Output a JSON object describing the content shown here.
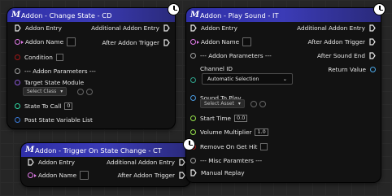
{
  "nodes": {
    "change_state": {
      "title": "Addon - Change State - CD",
      "inputs": {
        "addon_entry": "Addon Entry",
        "addon_name": "Addon Name",
        "condition": "Condition",
        "addon_params": "--- Addon Parameters ---",
        "target_state_module": "Target State Module",
        "select_class": "Select Class",
        "state_to_call": "State To Call",
        "state_to_call_value": "0",
        "post_state_variable_list": "Post State Variable List"
      },
      "outputs": {
        "additional_addon_entry": "Additional Addon Entry",
        "after_addon_trigger": "After Addon Trigger"
      }
    },
    "trigger_on_state_change": {
      "title": "Addon - Trigger On State Change - CT",
      "inputs": {
        "addon_entry": "Addon Entry",
        "addon_name": "Addon Name"
      },
      "outputs": {
        "additional_addon_entry": "Additional Addon Entry",
        "after_addon_trigger": "After Addon Trigger"
      }
    },
    "play_sound": {
      "title": "Addon - Play Sound - IT",
      "inputs": {
        "addon_entry": "Addon Entry",
        "addon_name": "Addon Name",
        "addon_params": "--- Addon Parameters ---",
        "channel_id": "Channel ID",
        "channel_value": "Automatic Selection",
        "sound_to_play": "Sound To Play",
        "select_asset": "Select Asset",
        "start_time": "Start Time",
        "start_time_value": "0.0",
        "volume_multiplier": "Volume Multiplier",
        "volume_multiplier_value": "1.0",
        "remove_on_get_hit": "Remove On Get Hit",
        "misc_params": "--- Misc Paramters ---",
        "manual_replay": "Manual Replay"
      },
      "outputs": {
        "additional_addon_entry": "Additional Addon Entry",
        "after_addon_trigger": "After Addon Trigger",
        "after_sound_end": "After Sound End",
        "return_value": "Return Value"
      }
    }
  },
  "colors": {
    "header": "#2f2fa8",
    "exec": "#e8e8e8",
    "string_pin": "#e07be8",
    "bool_pin": "#a21717",
    "struct_pin": "#a0a0a0",
    "class_pin": "#8a58d6",
    "int_pin": "#2fd7a3",
    "float_pin": "#97e34c",
    "array_pin": "#3b7bd8",
    "byte_pin": "#1f7a6a",
    "object_pin": "#4a9bdf",
    "return_pin": "#4aa7e6"
  },
  "icons": [
    "m-macro-icon",
    "clock-icon",
    "exec-pin-icon",
    "chevron-down-icon",
    "browse-icon",
    "use-selected-icon"
  ]
}
